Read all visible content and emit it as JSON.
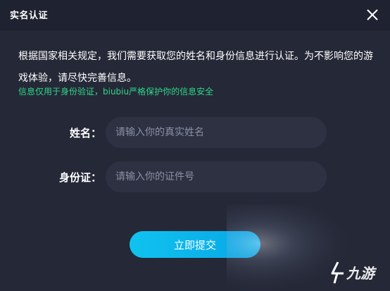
{
  "dialog": {
    "title": "实名认证",
    "close_icon": "close-icon",
    "description": "根据国家相关规定，我们需要获取您的姓名和身份信息进行认证。为不影响您的游戏体验，请尽快完善信息。",
    "note": "信息仅用于身份验证，biubiu严格保护你的信息安全",
    "note_color": "#2fd88a",
    "form": {
      "name_label": "姓名：",
      "name_placeholder": "请输入你的真实姓名",
      "id_label": "身份证：",
      "id_placeholder": "请输入你的证件号"
    },
    "submit_label": "立即提交",
    "accent_color": "#10c3ef",
    "background_color": "#252837"
  },
  "watermark": {
    "text": "九游",
    "icon": "jiuyou-logo-icon"
  }
}
